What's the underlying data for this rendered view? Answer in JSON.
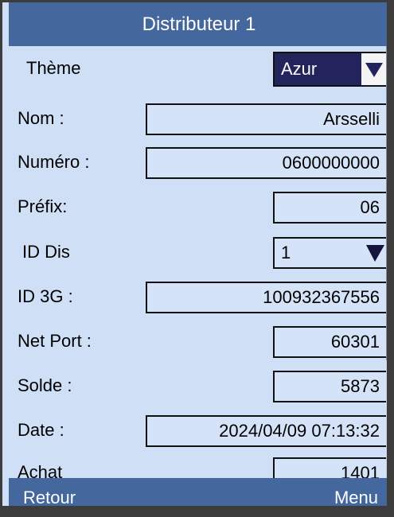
{
  "titlebar": {
    "title": "Distributeur 1"
  },
  "form": {
    "theme": {
      "label": "Thème",
      "value": "Azur"
    },
    "name": {
      "label": "Nom :",
      "value": "Arsselli"
    },
    "number": {
      "label": "Numéro :",
      "value": "0600000000"
    },
    "prefix": {
      "label": "Préfix:",
      "value": "06"
    },
    "dis_id": {
      "label": "ID Dis",
      "value": "1"
    },
    "id_3g": {
      "label": "ID 3G :",
      "value": "100932367556"
    },
    "net_port": {
      "label": "Net Port :",
      "value": "60301"
    },
    "balance": {
      "label": "Solde :",
      "value": "5873"
    },
    "date": {
      "label": "Date :",
      "value": "2024/04/09 07:13:32"
    },
    "purchase": {
      "label": "Achat",
      "value": "1401"
    }
  },
  "bottombar": {
    "back_label": "Retour",
    "menu_label": "Menu"
  },
  "colors": {
    "titlebar": "#44679e",
    "content_bg": "#cfe0f6",
    "theme_select_bg": "#24245c",
    "caret": "#14143c"
  },
  "icons": {
    "dropdown": "triangle-down-icon"
  }
}
